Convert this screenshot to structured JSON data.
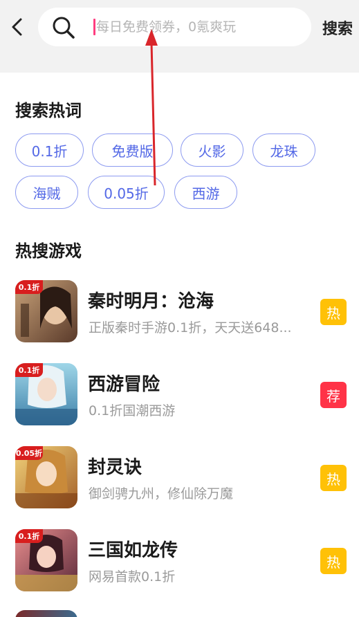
{
  "header": {
    "search_placeholder": "每日免费领券，0氪爽玩",
    "search_button": "搜索",
    "back_icon": "chevron-left-icon",
    "search_icon": "search-icon"
  },
  "hot_words": {
    "title": "搜索热词",
    "chips": [
      "0.1折",
      "免费版",
      "火影",
      "龙珠",
      "海贼",
      "0.05折",
      "西游"
    ]
  },
  "hot_games": {
    "title": "热搜游戏",
    "items": [
      {
        "title": "秦时明月：沧海",
        "desc": "正版秦时手游0.1折，天天送648...",
        "badge": "热",
        "badge_color": "#ffc107",
        "ribbon": "0.1折",
        "icon_art": "秦时明月"
      },
      {
        "title": "西游冒险",
        "desc": "0.1折国潮西游",
        "badge": "荐",
        "badge_color": "#ff3347",
        "ribbon": "0.1折",
        "icon_art": "新仙女"
      },
      {
        "title": "封灵诀",
        "desc": "御剑骋九州，修仙除万魔",
        "badge": "热",
        "badge_color": "#ffc107",
        "ribbon": "0.05折",
        "icon_art": "3D"
      },
      {
        "title": "三国如龙传",
        "desc": "网易首款0.1折",
        "badge": "热",
        "badge_color": "#ffc107",
        "ribbon": "0.1折",
        "icon_art": "护符觉醒"
      }
    ]
  },
  "colors": {
    "topbar_bg": "#f2f2f2",
    "chip_border": "#8c9af0",
    "chip_text": "#5368e6",
    "annotation_arrow": "#d9262b"
  }
}
